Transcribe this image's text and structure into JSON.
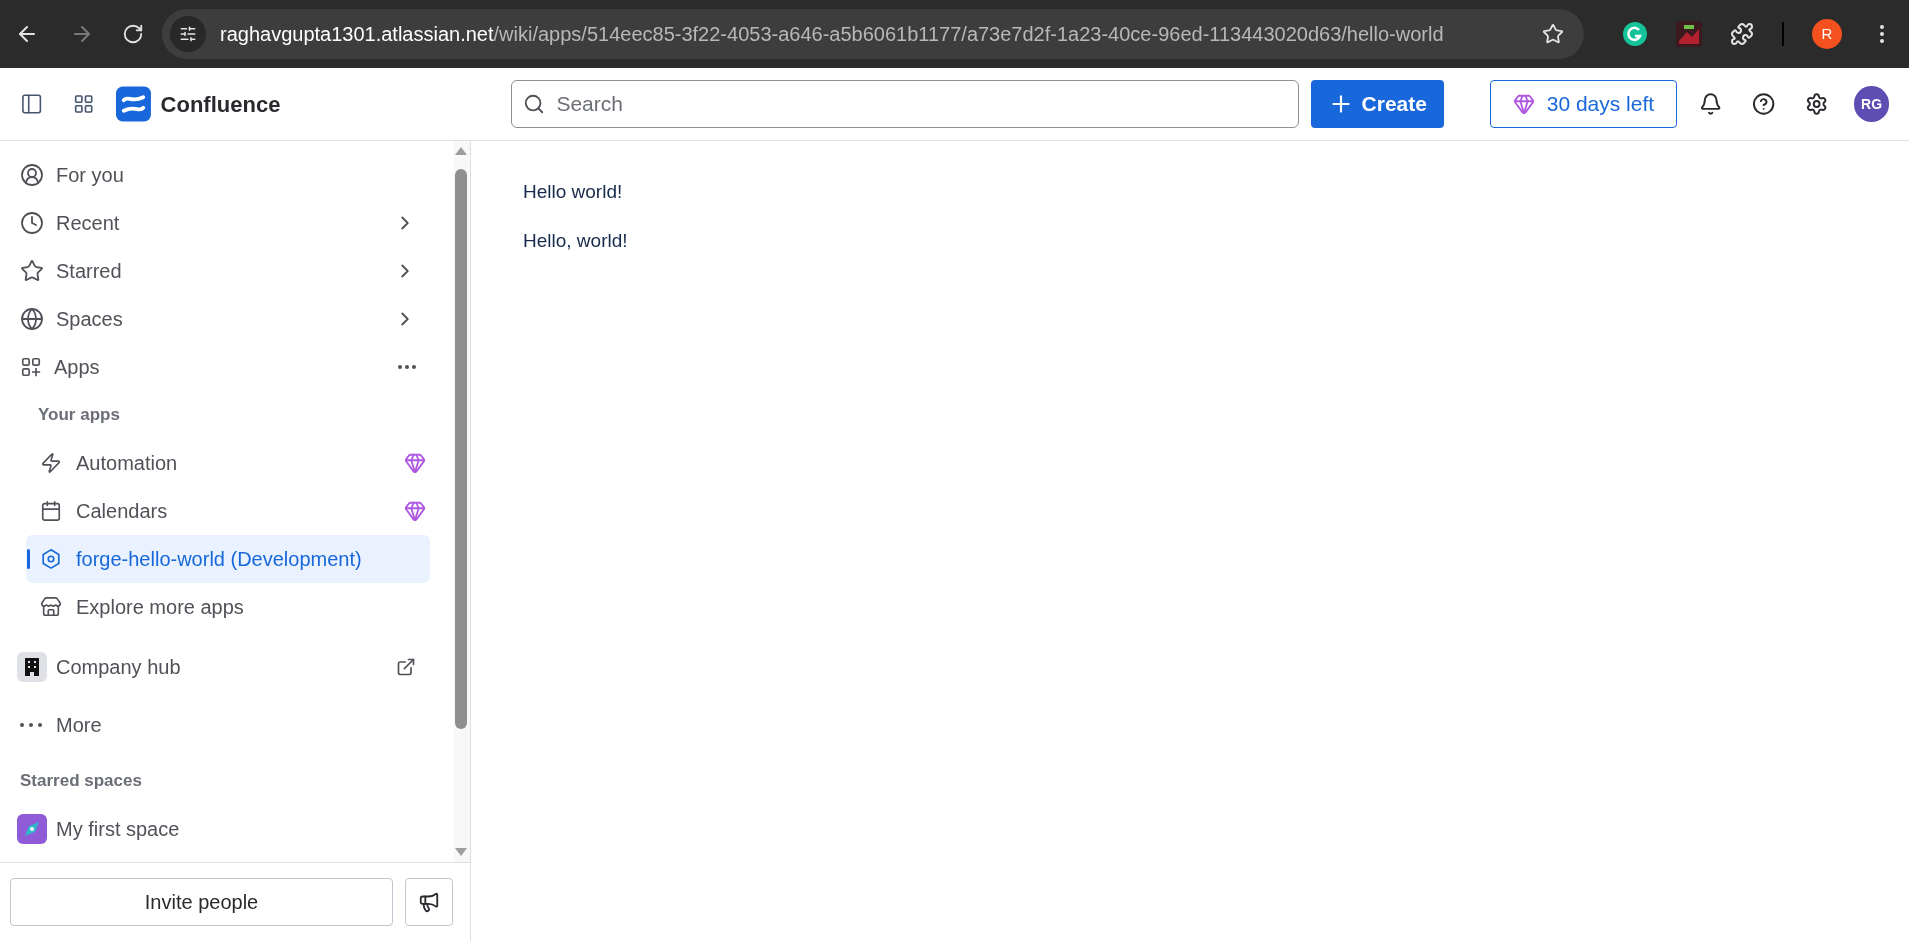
{
  "browser": {
    "url_host": "raghavgupta1301.atlassian.net",
    "url_path": "/wiki/apps/514eec85-3f22-4053-a646-a5b6061b1177/a73e7d2f-1a23-40ce-96ed-113443020d63/hello-world",
    "profile_initial": "R"
  },
  "header": {
    "product": "Confluence",
    "search": {
      "placeholder": "Search"
    },
    "create": "Create",
    "trial": "30 days left",
    "avatar": "RG"
  },
  "sidebar": {
    "nav": [
      {
        "label": "For you",
        "kind": "plain",
        "selected": false
      },
      {
        "label": "Recent",
        "kind": "expandable",
        "selected": false
      },
      {
        "label": "Starred",
        "kind": "expandable",
        "selected": false
      },
      {
        "label": "Spaces",
        "kind": "expandable",
        "selected": false
      },
      {
        "label": "Apps",
        "kind": "menu",
        "selected": false
      }
    ],
    "apps_heading": "Your apps",
    "apps": [
      {
        "label": "Automation",
        "premium": true,
        "selected": false
      },
      {
        "label": "Calendars",
        "premium": true,
        "selected": false
      },
      {
        "label": "forge-hello-world (Development)",
        "premium": false,
        "selected": true
      },
      {
        "label": "Explore more apps",
        "premium": false,
        "selected": false
      }
    ],
    "company_hub": "Company hub",
    "more": "More",
    "starred_heading": "Starred spaces",
    "starred_spaces": [
      {
        "label": "My first space"
      }
    ],
    "invite": "Invite people"
  },
  "content": {
    "paragraphs": [
      "Hello world!",
      "Hello, world!"
    ]
  }
}
